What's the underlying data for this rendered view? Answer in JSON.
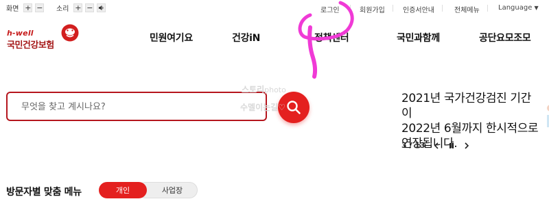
{
  "util": {
    "screen_label": "화면",
    "sound_label": "소리",
    "plus": "+",
    "minus": "−"
  },
  "top_links": {
    "login": "로그인",
    "join": "회원가입",
    "cert": "인증서안내",
    "sitemap": "전체메뉴",
    "language": "Language",
    "language_caret": "▼"
  },
  "logo": {
    "en": "h-well",
    "ko": "국민건강보험"
  },
  "gnb": [
    "민원여기요",
    "건강iN",
    "정책센터",
    "국민과함께",
    "공단요모조모"
  ],
  "search": {
    "placeholder": "무엇을 찾고 계시나요?"
  },
  "watermark": {
    "line1_bold": "스토리",
    "line1_light": "photo",
    "line2": "수멜이는길♡"
  },
  "news": {
    "line1": "2021년 국가건강검진 기간이",
    "line2": "2022년 6월까지 한시적으로",
    "line3": "연장됩니다.",
    "current": "3",
    "total": "13",
    "separator": "/"
  },
  "visitor_menu": {
    "title": "방문자별 맞춤 메뉴",
    "tab_personal": "개인",
    "tab_business": "사업장"
  },
  "colors": {
    "brand_red": "#e4201f",
    "dark_red": "#b5151d",
    "annotation_magenta": "#f03ad6"
  },
  "icons": [
    "volume-icon",
    "search-icon",
    "prev-icon",
    "pause-icon",
    "next-icon",
    "logo-mark-icon"
  ]
}
